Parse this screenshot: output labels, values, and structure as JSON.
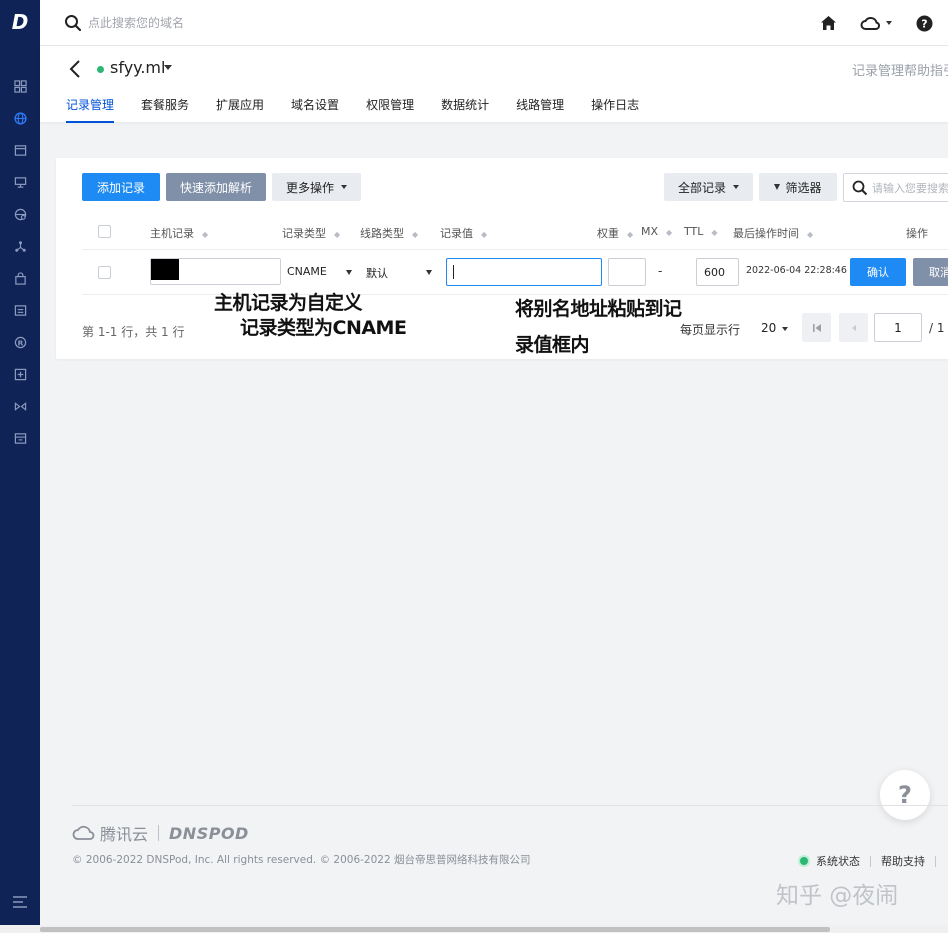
{
  "sidebar": {
    "logo": "D",
    "icons": [
      "dashboard-icon",
      "globe-icon",
      "calendar-icon",
      "monitor-icon",
      "global-settings-icon",
      "network-icon",
      "lock-bag-icon",
      "list-icon",
      "registered-icon",
      "plus-box-icon",
      "link-icon",
      "box-icon"
    ],
    "bottom_icon": "menu-collapse-icon",
    "bg_color": "#0f2356",
    "active_color": "#2f7bf5"
  },
  "topbar": {
    "search_placeholder": "点此搜索您的域名",
    "icons": [
      "home-icon",
      "cloud-icon",
      "help-circle-icon"
    ]
  },
  "domain": {
    "name": "sfyy.ml",
    "help_link": "记录管理帮助指引",
    "tabs": [
      "记录管理",
      "套餐服务",
      "扩展应用",
      "域名设置",
      "权限管理",
      "数据统计",
      "线路管理",
      "操作日志"
    ],
    "active_tab": 0
  },
  "toolbar": {
    "add_record": "添加记录",
    "quick_add": "快速添加解析",
    "more_ops": "更多操作",
    "all_records": "全部记录",
    "filter": "筛选器",
    "search_placeholder": "请输入您要搜索的记录"
  },
  "table": {
    "headers": {
      "host": "主机记录",
      "type": "记录类型",
      "line": "线路类型",
      "value": "记录值",
      "weight": "权重",
      "mx": "MX",
      "ttl": "TTL",
      "last_op": "最后操作时间",
      "ops": "操作"
    },
    "row": {
      "host": "",
      "type": "CNAME",
      "line": "默认",
      "value": "",
      "weight": "",
      "mx": "-",
      "ttl": "600",
      "time": "2022-06-04 22:28:46",
      "confirm": "确认",
      "cancel": "取消"
    }
  },
  "pagination": {
    "info": "第 1-1 行，共 1 行",
    "per_page_label": "每页显示行",
    "per_page": "20",
    "current_page": "1",
    "total": "/ 1"
  },
  "annotations": {
    "line1": "主机记录为自定义",
    "line2": "记录类型为CNAME",
    "line3": "将别名地址粘贴到记",
    "line4": "录值框内"
  },
  "footer": {
    "brand1": "腾讯云",
    "brand2": "DNSPOD",
    "copyright": "© 2006-2022 DNSPod, Inc. All rights reserved. © 2006-2022 烟台帝思普网络科技有限公司",
    "system_status": "系统状态",
    "help_support": "帮助支持",
    "help_bubble": "?",
    "watermark": "知乎 @夜闹"
  }
}
